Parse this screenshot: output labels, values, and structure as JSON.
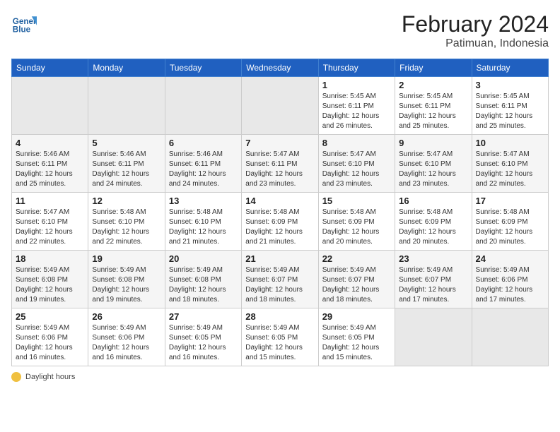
{
  "header": {
    "logo_line1": "General",
    "logo_line2": "Blue",
    "title": "February 2024",
    "subtitle": "Patimuan, Indonesia"
  },
  "calendar": {
    "columns": [
      "Sunday",
      "Monday",
      "Tuesday",
      "Wednesday",
      "Thursday",
      "Friday",
      "Saturday"
    ],
    "weeks": [
      [
        {
          "day": "",
          "info": ""
        },
        {
          "day": "",
          "info": ""
        },
        {
          "day": "",
          "info": ""
        },
        {
          "day": "",
          "info": ""
        },
        {
          "day": "1",
          "info": "Sunrise: 5:45 AM\nSunset: 6:11 PM\nDaylight: 12 hours and 26 minutes."
        },
        {
          "day": "2",
          "info": "Sunrise: 5:45 AM\nSunset: 6:11 PM\nDaylight: 12 hours and 25 minutes."
        },
        {
          "day": "3",
          "info": "Sunrise: 5:45 AM\nSunset: 6:11 PM\nDaylight: 12 hours and 25 minutes."
        }
      ],
      [
        {
          "day": "4",
          "info": "Sunrise: 5:46 AM\nSunset: 6:11 PM\nDaylight: 12 hours and 25 minutes."
        },
        {
          "day": "5",
          "info": "Sunrise: 5:46 AM\nSunset: 6:11 PM\nDaylight: 12 hours and 24 minutes."
        },
        {
          "day": "6",
          "info": "Sunrise: 5:46 AM\nSunset: 6:11 PM\nDaylight: 12 hours and 24 minutes."
        },
        {
          "day": "7",
          "info": "Sunrise: 5:47 AM\nSunset: 6:11 PM\nDaylight: 12 hours and 23 minutes."
        },
        {
          "day": "8",
          "info": "Sunrise: 5:47 AM\nSunset: 6:10 PM\nDaylight: 12 hours and 23 minutes."
        },
        {
          "day": "9",
          "info": "Sunrise: 5:47 AM\nSunset: 6:10 PM\nDaylight: 12 hours and 23 minutes."
        },
        {
          "day": "10",
          "info": "Sunrise: 5:47 AM\nSunset: 6:10 PM\nDaylight: 12 hours and 22 minutes."
        }
      ],
      [
        {
          "day": "11",
          "info": "Sunrise: 5:47 AM\nSunset: 6:10 PM\nDaylight: 12 hours and 22 minutes."
        },
        {
          "day": "12",
          "info": "Sunrise: 5:48 AM\nSunset: 6:10 PM\nDaylight: 12 hours and 22 minutes."
        },
        {
          "day": "13",
          "info": "Sunrise: 5:48 AM\nSunset: 6:10 PM\nDaylight: 12 hours and 21 minutes."
        },
        {
          "day": "14",
          "info": "Sunrise: 5:48 AM\nSunset: 6:09 PM\nDaylight: 12 hours and 21 minutes."
        },
        {
          "day": "15",
          "info": "Sunrise: 5:48 AM\nSunset: 6:09 PM\nDaylight: 12 hours and 20 minutes."
        },
        {
          "day": "16",
          "info": "Sunrise: 5:48 AM\nSunset: 6:09 PM\nDaylight: 12 hours and 20 minutes."
        },
        {
          "day": "17",
          "info": "Sunrise: 5:48 AM\nSunset: 6:09 PM\nDaylight: 12 hours and 20 minutes."
        }
      ],
      [
        {
          "day": "18",
          "info": "Sunrise: 5:49 AM\nSunset: 6:08 PM\nDaylight: 12 hours and 19 minutes."
        },
        {
          "day": "19",
          "info": "Sunrise: 5:49 AM\nSunset: 6:08 PM\nDaylight: 12 hours and 19 minutes."
        },
        {
          "day": "20",
          "info": "Sunrise: 5:49 AM\nSunset: 6:08 PM\nDaylight: 12 hours and 18 minutes."
        },
        {
          "day": "21",
          "info": "Sunrise: 5:49 AM\nSunset: 6:07 PM\nDaylight: 12 hours and 18 minutes."
        },
        {
          "day": "22",
          "info": "Sunrise: 5:49 AM\nSunset: 6:07 PM\nDaylight: 12 hours and 18 minutes."
        },
        {
          "day": "23",
          "info": "Sunrise: 5:49 AM\nSunset: 6:07 PM\nDaylight: 12 hours and 17 minutes."
        },
        {
          "day": "24",
          "info": "Sunrise: 5:49 AM\nSunset: 6:06 PM\nDaylight: 12 hours and 17 minutes."
        }
      ],
      [
        {
          "day": "25",
          "info": "Sunrise: 5:49 AM\nSunset: 6:06 PM\nDaylight: 12 hours and 16 minutes."
        },
        {
          "day": "26",
          "info": "Sunrise: 5:49 AM\nSunset: 6:06 PM\nDaylight: 12 hours and 16 minutes."
        },
        {
          "day": "27",
          "info": "Sunrise: 5:49 AM\nSunset: 6:05 PM\nDaylight: 12 hours and 16 minutes."
        },
        {
          "day": "28",
          "info": "Sunrise: 5:49 AM\nSunset: 6:05 PM\nDaylight: 12 hours and 15 minutes."
        },
        {
          "day": "29",
          "info": "Sunrise: 5:49 AM\nSunset: 6:05 PM\nDaylight: 12 hours and 15 minutes."
        },
        {
          "day": "",
          "info": ""
        },
        {
          "day": "",
          "info": ""
        }
      ]
    ]
  },
  "footer": {
    "note": "Daylight hours"
  }
}
